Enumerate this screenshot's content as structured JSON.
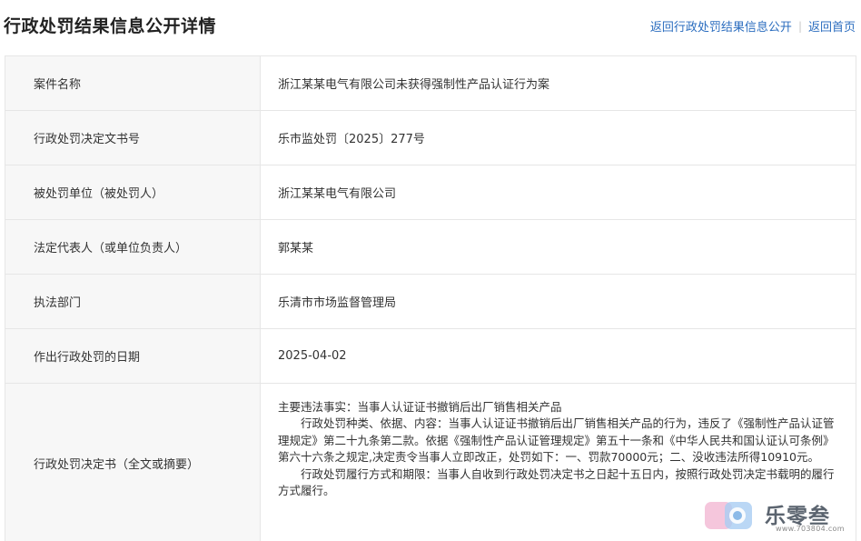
{
  "header": {
    "title": "行政处罚结果信息公开详情",
    "links": [
      "返回行政处罚结果信息公开",
      "返回首页"
    ]
  },
  "details": {
    "rows": [
      {
        "label": "案件名称",
        "value": "浙江某某电气有限公司未获得强制性产品认证行为案"
      },
      {
        "label": "行政处罚决定文书号",
        "value": "乐市监处罚〔2025〕277号"
      },
      {
        "label": "被处罚单位（被处罚人）",
        "value": "浙江某某电气有限公司"
      },
      {
        "label": "法定代表人（或单位负责人）",
        "value": "郭某某"
      },
      {
        "label": "执法部门",
        "value": "乐清市市场监督管理局"
      },
      {
        "label": "作出行政处罚的日期",
        "value": "2025-04-02"
      }
    ],
    "decision": {
      "label": "行政处罚决定书（全文或摘要）",
      "paragraphs": [
        "主要违法事实：当事人认证证书撤销后出厂销售相关产品",
        "行政处罚种类、依据、内容：当事人认证证书撤销后出厂销售相关产品的行为，违反了《强制性产品认证管理规定》第二十九条第二款。依据《强制性产品认证管理规定》第五十一条和《中华人民共和国认证认可条例》第六十六条之规定,决定责令当事人立即改正，处罚如下：一、罚款70000元；二、没收违法所得10910元。",
        "行政处罚履行方式和期限：当事人自收到行政处罚决定书之日起十五日内，按照行政处罚决定书载明的履行方式履行。"
      ]
    }
  },
  "watermark": {
    "brand": "乐零叁",
    "url": "www.703804.com"
  },
  "colors": {
    "link": "#2b6dbf",
    "label_bg": "#f7f7f7",
    "border": "#e6e6e6"
  }
}
